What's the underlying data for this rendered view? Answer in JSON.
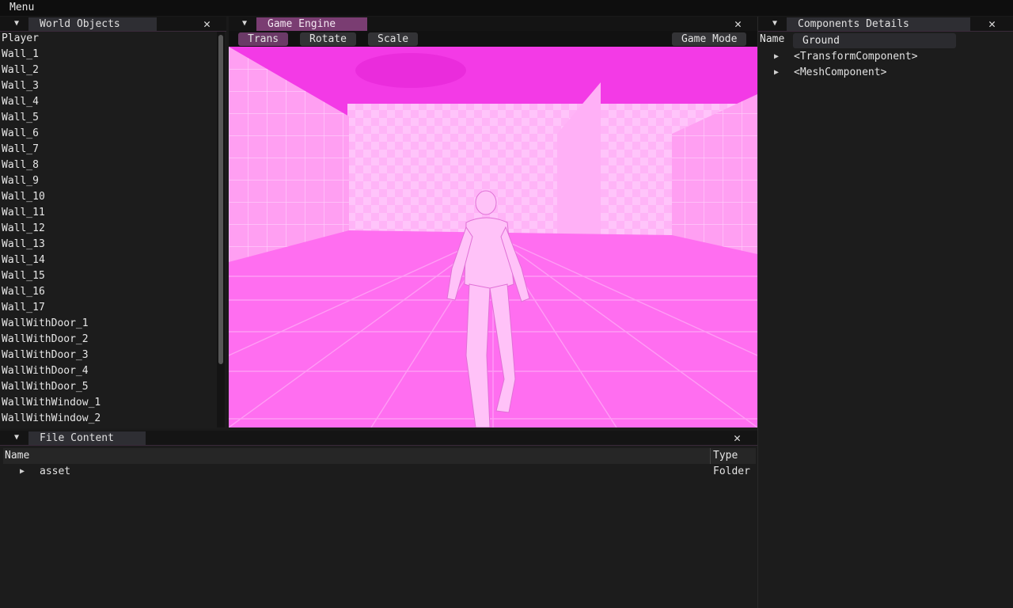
{
  "menubar": {
    "label": "Menu"
  },
  "world_objects": {
    "title": "World Objects",
    "items": [
      "Player",
      "Wall_1",
      "Wall_2",
      "Wall_3",
      "Wall_4",
      "Wall_5",
      "Wall_6",
      "Wall_7",
      "Wall_8",
      "Wall_9",
      "Wall_10",
      "Wall_11",
      "Wall_12",
      "Wall_13",
      "Wall_14",
      "Wall_15",
      "Wall_16",
      "Wall_17",
      "WallWithDoor_1",
      "WallWithDoor_2",
      "WallWithDoor_3",
      "WallWithDoor_4",
      "WallWithDoor_5",
      "WallWithWindow_1",
      "WallWithWindow_2"
    ]
  },
  "game_engine": {
    "title": "Game Engine",
    "toolbar": {
      "trans": "Trans",
      "rotate": "Rotate",
      "scale": "Scale",
      "game_mode": "Game Mode"
    },
    "active_tool": "Trans"
  },
  "components": {
    "title": "Components Details",
    "name_label": "Name",
    "name_value": "Ground",
    "items": [
      "<TransformComponent>",
      "<MeshComponent>"
    ]
  },
  "file_content": {
    "title": "File Content",
    "columns": {
      "name": "Name",
      "type": "Type"
    },
    "rows": [
      {
        "name": "asset",
        "type": "Folder"
      }
    ]
  },
  "icons": {
    "tab_menu": "triangle-down-icon",
    "close": "close-icon",
    "expand": "triangle-right-icon"
  },
  "colors": {
    "accent": "#7a3d72",
    "viewport_tint": "#ff55ee",
    "background": "#1a1a1a"
  },
  "glyphs": {
    "down": "▼",
    "right": "▶",
    "close": "✕"
  }
}
